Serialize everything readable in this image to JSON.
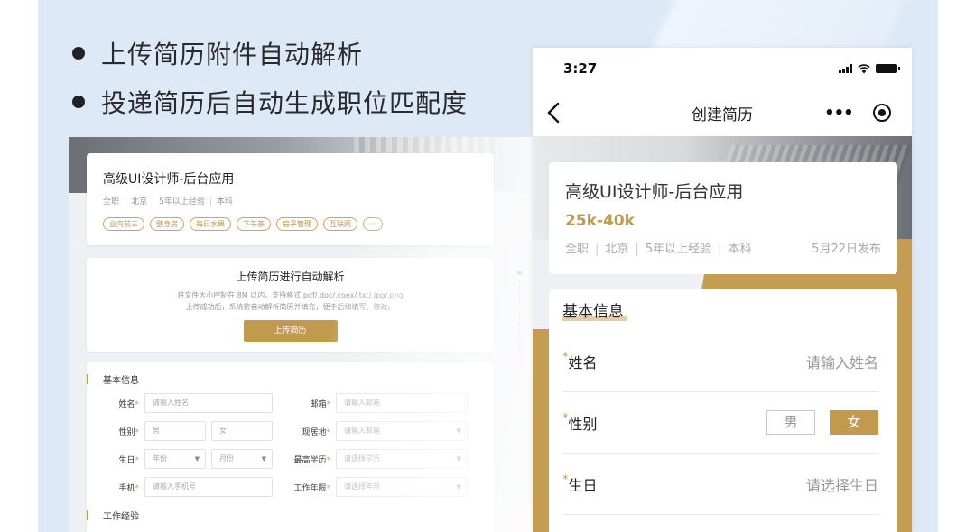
{
  "bullets": [
    "上传简历附件自动解析",
    "投递简历后自动生成职位匹配度"
  ],
  "desktop": {
    "job": {
      "title": "高级UI设计师-后台应用",
      "meta": [
        "全职",
        "北京",
        "5年以上经验",
        "本科"
      ],
      "tags": [
        "业内前三",
        "健身房",
        "每日水果",
        "下午茶",
        "扁平管理",
        "互联网",
        "···"
      ]
    },
    "upload": {
      "title": "上传简历进行自动解析",
      "hint1": "将文件大小控制在 8M 以内，支持格式 pdf/.doc/.coex/.txt/.jpg/.png",
      "hint2": "上传成功后，系统将自动解析简历并填充，便于后续填写、修改。",
      "button": "上传简历"
    },
    "form": {
      "section_basic": "基本信息",
      "section_work": "工作经验",
      "name_label": "姓名",
      "name_ph": "请输入姓名",
      "email_label": "邮箱",
      "email_ph": "请输入邮箱",
      "gender_label": "性别",
      "gender_male": "男",
      "gender_female": "女",
      "location_label": "现居地",
      "location_ph": "请输入邮箱",
      "birth_label": "生日",
      "birth_year": "年份",
      "birth_month": "月份",
      "edu_label": "最高学历",
      "edu_ph": "请选择学历",
      "phone_label": "手机",
      "phone_ph": "请输入手机号",
      "years_label": "工作年限",
      "years_ph": "请选择年限",
      "required_mark": "*"
    }
  },
  "phone": {
    "time": "3:27",
    "nav_title": "创建简历",
    "more": "•••",
    "job": {
      "title": "高级UI设计师-后台应用",
      "salary": "25k-40k",
      "meta": [
        "全职",
        "北京",
        "5年以上经验",
        "本科"
      ],
      "date": "5月22日发布"
    },
    "form": {
      "section": "基本信息",
      "required_mark": "*",
      "name_label": "姓名",
      "name_ph": "请输入姓名",
      "gender_label": "性别",
      "male": "男",
      "female": "女",
      "birth_label": "生日",
      "birth_ph": "请选择生日"
    }
  },
  "colors": {
    "accent": "#c29a4e",
    "background": "#dde9f7"
  }
}
